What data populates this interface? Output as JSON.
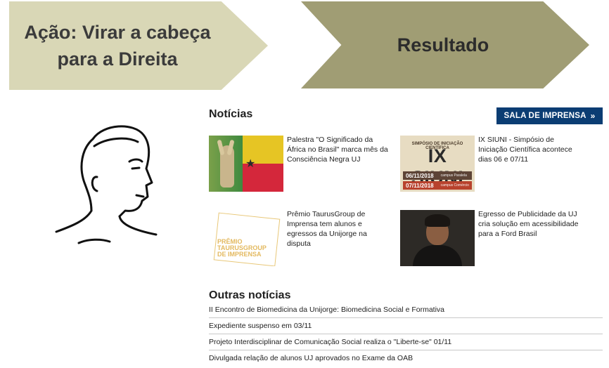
{
  "header": {
    "action_line1": "Ação: Virar a cabeça",
    "action_line2": "para a Direita",
    "result": "Resultado"
  },
  "colors": {
    "action_arrow": "#d9d7b6",
    "result_arrow": "#a09d74",
    "press_button": "#0b3d73"
  },
  "news": {
    "title": "Notícias",
    "press_room_label": "SALA DE IMPRENSA",
    "press_room_icon": "double-chevron-right-icon",
    "items": [
      {
        "text": "Palestra \"O Significado da África no Brasil\" marca mês da Consciência Negra UJ"
      },
      {
        "text": "IX SIUNI - Simpósio de Iniciação Científica acontece dias 06 e 07/11"
      },
      {
        "text": "Prêmio TaurusGroup de Imprensa tem alunos e egressos da Unijorge na disputa"
      },
      {
        "text": "Egresso de Publicidade da UJ cria solução em acessibilidade para a Ford Brasil"
      }
    ],
    "siuni_thumb": {
      "top": "SIMPÓSIO DE INICIAÇÃO CIENTÍFICA",
      "big": "IX SIUNI",
      "date1": "06/11/2018",
      "campus1": "campus Paralela",
      "date2": "07/11/2018",
      "campus2": "campus Comércio"
    },
    "premio_thumb": {
      "line1": "PRÊMIO",
      "line2": "TAURUSGROUP",
      "line3": "DE IMPRENSA"
    }
  },
  "other_news": {
    "title": "Outras notícias",
    "items": [
      "II Encontro de Biomedicina da Unijorge: Biomedicina Social e Formativa",
      "Expediente suspenso em 03/11",
      "Projeto Interdisciplinar de Comunicação Social realiza o \"Liberte-se\" 01/11",
      "Divulgada relação de alunos UJ aprovados no Exame da OAB"
    ]
  }
}
